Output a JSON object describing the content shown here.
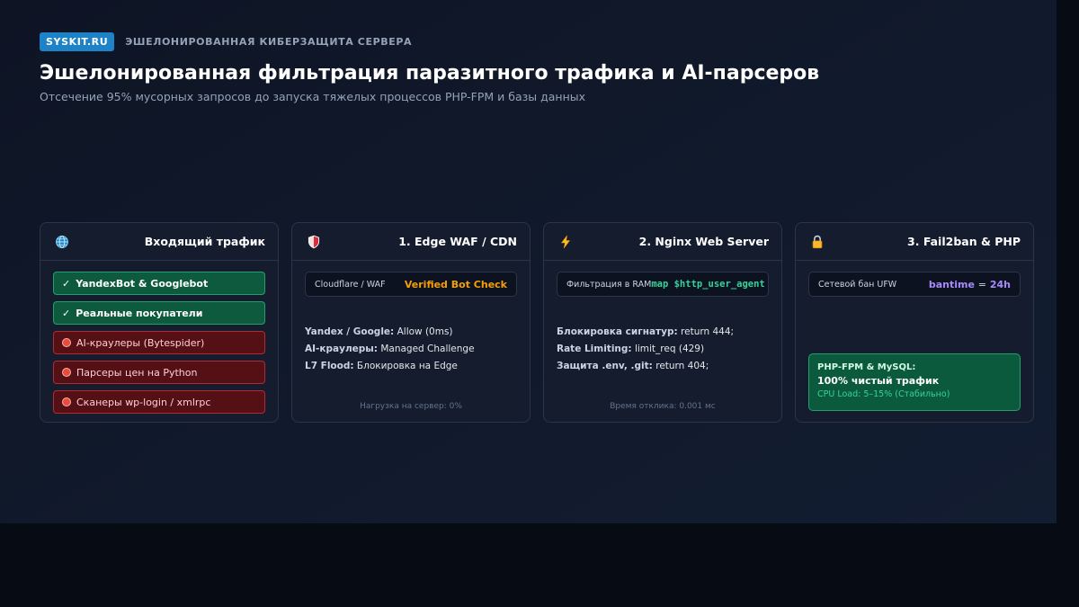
{
  "header": {
    "brand": "SYSKIT.RU",
    "tagline": "ЭШЕЛОНИРОВАННАЯ КИБЕРЗАЩИТА СЕРВЕРА",
    "title": "Эшелонированная фильтрация паразитного трафика и AI-парсеров",
    "subtitle": "Отсечение 95% мусорных запросов до запуска тяжелых процессов PHP-FPM и базы данных"
  },
  "colors": {
    "accent": "#1d83c6",
    "allowed": "#22a06b",
    "blocked": "#b42a33",
    "edge_value": "#f59e0b",
    "nginx_value": "#34d399",
    "fail2ban_value": "#a78bfa"
  },
  "incoming": {
    "title": "Входящий трафик",
    "icon": "globe-icon",
    "allowed": [
      {
        "check": "✓",
        "label": "YandexBot & Googlebot"
      },
      {
        "check": "✓",
        "label": "Реальные покупатели"
      }
    ],
    "blocked": [
      {
        "label": "AI-краулеры (Bytespider)"
      },
      {
        "label": "Парсеры цен на Python"
      },
      {
        "label": "Сканеры wp-login / xmlrpc"
      }
    ]
  },
  "edge": {
    "title": "1. Edge WAF / CDN",
    "icon": "shield-icon",
    "field_label": "Cloudflare / WAF",
    "field_value": "Verified Bot Check",
    "rules": [
      {
        "key": "Yandex / Google:",
        "value": "Allow (0ms)"
      },
      {
        "key": "AI-краулеры:",
        "value": "Managed Challenge"
      },
      {
        "key": "L7 Flood:",
        "value": "Блокировка на Edge"
      }
    ],
    "footer": "Нагрузка на сервер: 0%"
  },
  "nginx": {
    "title": "2. Nginx Web Server",
    "icon": "lightning-icon",
    "field_label": "Фильтрация в RAM",
    "field_value": "map $http_user_agent",
    "rules": [
      {
        "key": "Блокировка сигнатур:",
        "value": "return 444;"
      },
      {
        "key": "Rate Limiting:",
        "value": "limit_req (429)"
      },
      {
        "key": "Защита .env, .git:",
        "value": "return 404;"
      }
    ],
    "footer": "Время отклика: 0.001 мс"
  },
  "fail2ban": {
    "title": "3. Fail2ban & PHP",
    "icon": "lock-icon",
    "field_label": "Сетевой бан UFW",
    "field_value_key": "bantime",
    "field_value_eq": "=",
    "field_value_val": "24h",
    "result": {
      "title": "PHP-FPM & MySQL:",
      "main": "100% чистый трафик",
      "sub": "CPU Load: 5–15% (Стабильно)"
    }
  }
}
